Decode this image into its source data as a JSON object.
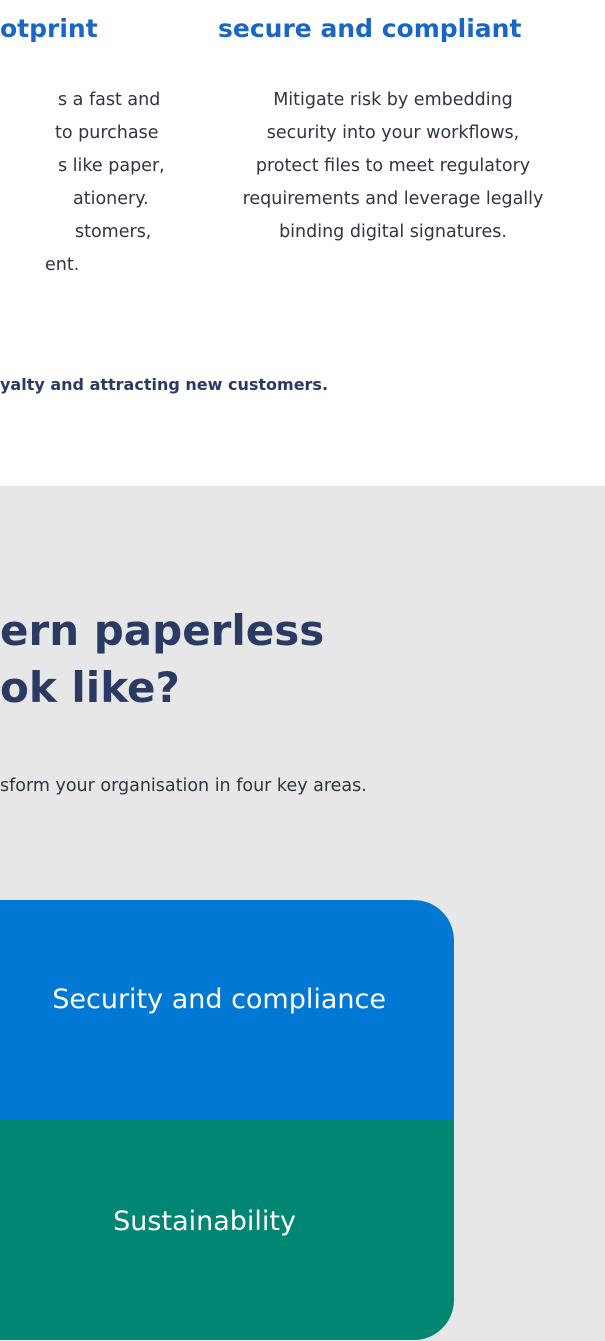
{
  "top_section": {
    "left_heading": "otprint",
    "right_heading": "secure and compliant",
    "left_text_lines": [
      "s a fast and",
      "to purchase",
      "s like paper,",
      "ationery.",
      "stomers,",
      "ent."
    ],
    "right_text_lines": [
      "Mitigate risk by embedding",
      "security into your workflows,",
      "protect files to meet regulatory",
      "requirements and leverage legally",
      "binding digital signatures."
    ],
    "tagline": "yalty and attracting new customers."
  },
  "grey_section": {
    "title_lines": [
      "ern paperless",
      "ok like?"
    ],
    "subtext": "sform your organisation in four key areas.",
    "cards": [
      {
        "label": "Security and compliance",
        "color": "#0078d4"
      },
      {
        "label": "Sustainability",
        "color": "#008672"
      }
    ]
  },
  "colors": {
    "heading_blue": "#1a66c7",
    "navy_text": "#2a3a63",
    "body_text": "#2f3542",
    "grey_background": "#e7e7e7"
  }
}
